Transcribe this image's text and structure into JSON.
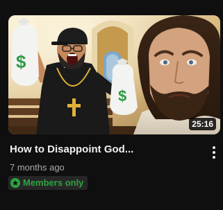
{
  "video": {
    "title": "How to Disappoint God...",
    "duration": "25:16",
    "published": "7 months ago",
    "badge": {
      "label": "Members only",
      "icon": "star-icon",
      "color": "#2ba640"
    },
    "menu_icon": "more-vert-icon",
    "thumbnail": {
      "bag_symbol": "$",
      "left_figure": "shouting-man-with-money-bags",
      "right_figure": "sad-bearded-man"
    }
  },
  "colors": {
    "background": "#0f0f0f",
    "title": "#f1f1f1",
    "meta": "#aaaaaa",
    "badge_bg": "#272727",
    "badge_accent": "#2ba640"
  }
}
